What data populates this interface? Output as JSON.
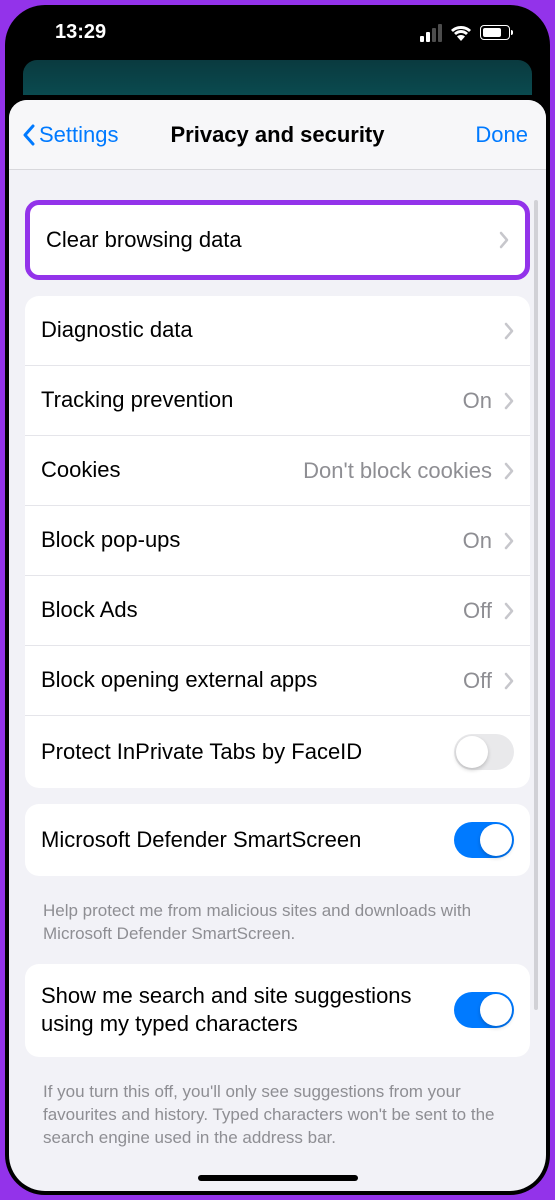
{
  "status_bar": {
    "time": "13:29"
  },
  "nav": {
    "back_label": "Settings",
    "title": "Privacy and security",
    "done_label": "Done"
  },
  "sections": {
    "group1": [
      {
        "label": "Clear browsing data",
        "value": "",
        "has_chevron": true,
        "highlighted": true
      },
      {
        "label": "Diagnostic data",
        "value": "",
        "has_chevron": true
      },
      {
        "label": "Tracking prevention",
        "value": "On",
        "has_chevron": true
      },
      {
        "label": "Cookies",
        "value": "Don't block cookies",
        "has_chevron": true
      },
      {
        "label": "Block pop-ups",
        "value": "On",
        "has_chevron": true
      },
      {
        "label": "Block Ads",
        "value": "Off",
        "has_chevron": true
      },
      {
        "label": "Block opening external apps",
        "value": "Off",
        "has_chevron": true
      },
      {
        "label": "Protect InPrivate Tabs by FaceID",
        "toggle": false
      }
    ],
    "group2": {
      "row": {
        "label": "Microsoft Defender SmartScreen",
        "toggle": true
      },
      "footer": "Help protect me from malicious sites and downloads with Microsoft Defender SmartScreen."
    },
    "group3": {
      "row": {
        "label": "Show me search and site suggestions using my typed characters",
        "toggle": true
      },
      "footer": "If you turn this off, you'll only see suggestions from your favourites and history. Typed characters won't be sent to the search engine used in the address bar."
    }
  }
}
